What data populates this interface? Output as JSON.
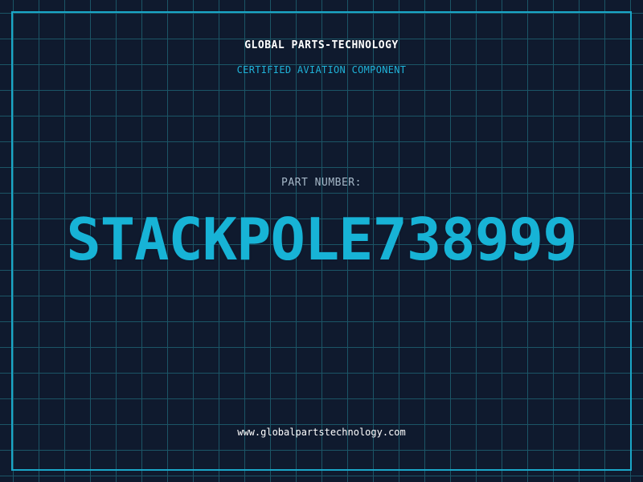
{
  "header": {
    "company": "GLOBAL PARTS-TECHNOLOGY",
    "subtitle": "CERTIFIED AVIATION COMPONENT"
  },
  "part": {
    "label": "PART NUMBER:",
    "number": "STACKPOLE738999"
  },
  "footer": {
    "url": "www.globalpartstechnology.com"
  },
  "colors": {
    "background": "#0f1a2e",
    "grid": "#1b5566",
    "accent": "#17b3d6",
    "text": "#ffffff",
    "label": "#a6b8c8"
  }
}
